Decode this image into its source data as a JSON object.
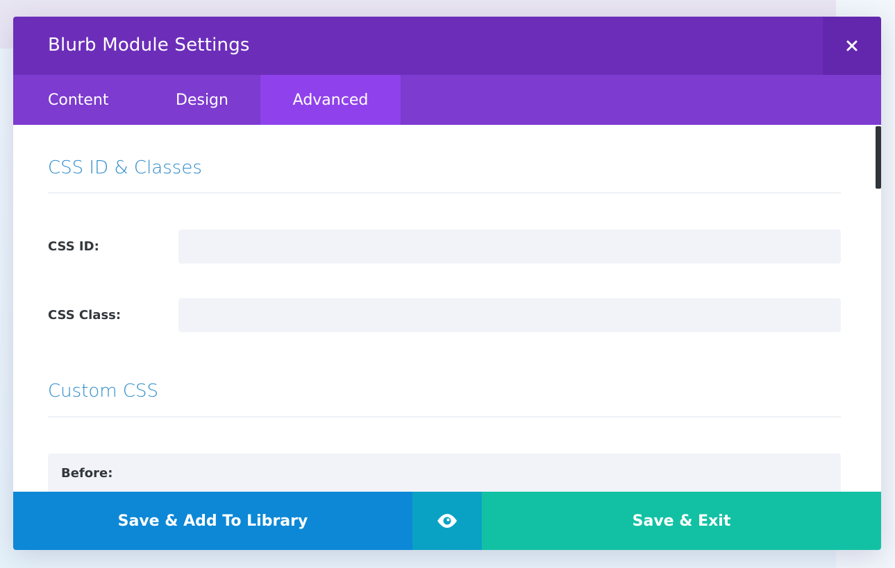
{
  "modal": {
    "title": "Blurb Module Settings",
    "close_icon": "close-icon"
  },
  "tabs": [
    {
      "label": "Content",
      "active": false
    },
    {
      "label": "Design",
      "active": false
    },
    {
      "label": "Advanced",
      "active": true
    }
  ],
  "sections": {
    "css_id_classes": {
      "title": "CSS ID & Classes",
      "fields": [
        {
          "label": "CSS ID:",
          "value": "",
          "placeholder": ""
        },
        {
          "label": "CSS Class:",
          "value": "",
          "placeholder": ""
        }
      ]
    },
    "custom_css": {
      "title": "Custom CSS",
      "before_label": "Before:"
    }
  },
  "footer": {
    "save_library_label": "Save & Add To Library",
    "preview_icon": "eye-icon",
    "save_exit_label": "Save & Exit"
  },
  "colors": {
    "header": "#6c2eb9",
    "tab_bar": "#7d3bcf",
    "tab_active": "#8f42ec",
    "section_title": "#2e8bc9",
    "save_library": "#0c88d6",
    "preview": "#0aa2c4",
    "save_exit": "#12c1a4"
  }
}
